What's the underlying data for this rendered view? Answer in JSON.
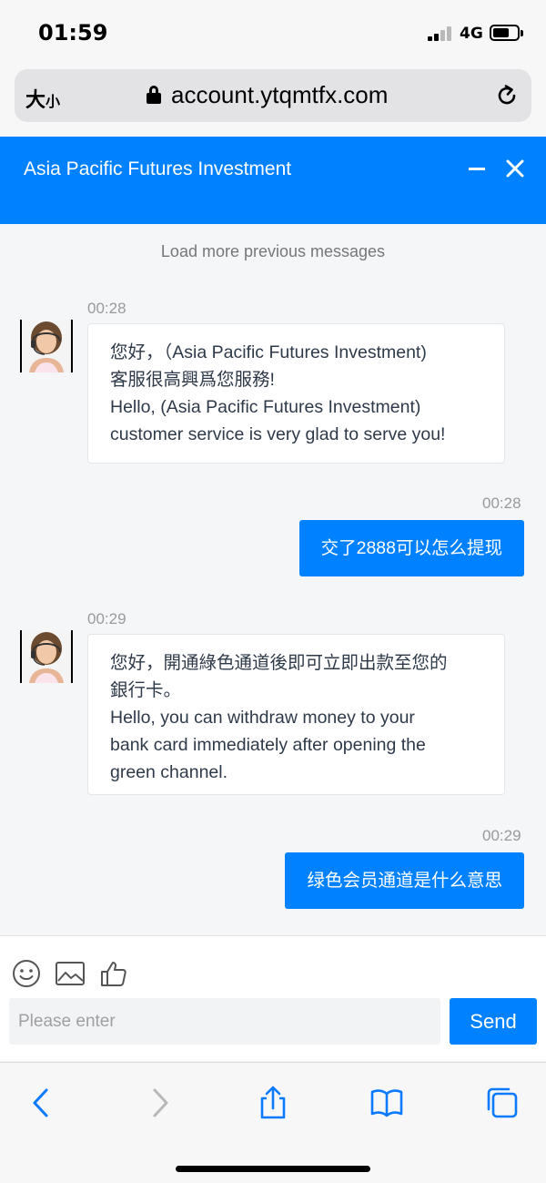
{
  "status_bar": {
    "time": "01:59",
    "network": "4G",
    "signal_bars": 2,
    "signal_total": 4
  },
  "browser": {
    "text_size_big": "大",
    "text_size_small": "小",
    "url": "account.ytqmtfx.com"
  },
  "header": {
    "title": "Asia Pacific Futures Investment"
  },
  "chat": {
    "load_more": "Load more previous messages",
    "messages": [
      {
        "direction": "in",
        "time": "00:28",
        "lines": [
          "您好，（Asia Pacific Futures Investment)",
          "客服很高興爲您服務!",
          "Hello, (Asia Pacific Futures Investment)",
          "customer service is very glad to serve you!"
        ]
      },
      {
        "direction": "out",
        "time": "00:28",
        "text": "交了2888可以怎么提现"
      },
      {
        "direction": "in",
        "time": "00:29",
        "lines": [
          "您好，開通綠色通道後即可立即出款至您的",
          "銀行卡。",
          "Hello, you can withdraw money to your",
          "bank card immediately after opening the",
          "green channel."
        ]
      },
      {
        "direction": "out",
        "time": "00:29",
        "text": "绿色会员通道是什么意思"
      }
    ]
  },
  "composer": {
    "placeholder": "Please enter",
    "send_label": "Send"
  },
  "colors": {
    "accent": "#0081ff"
  }
}
